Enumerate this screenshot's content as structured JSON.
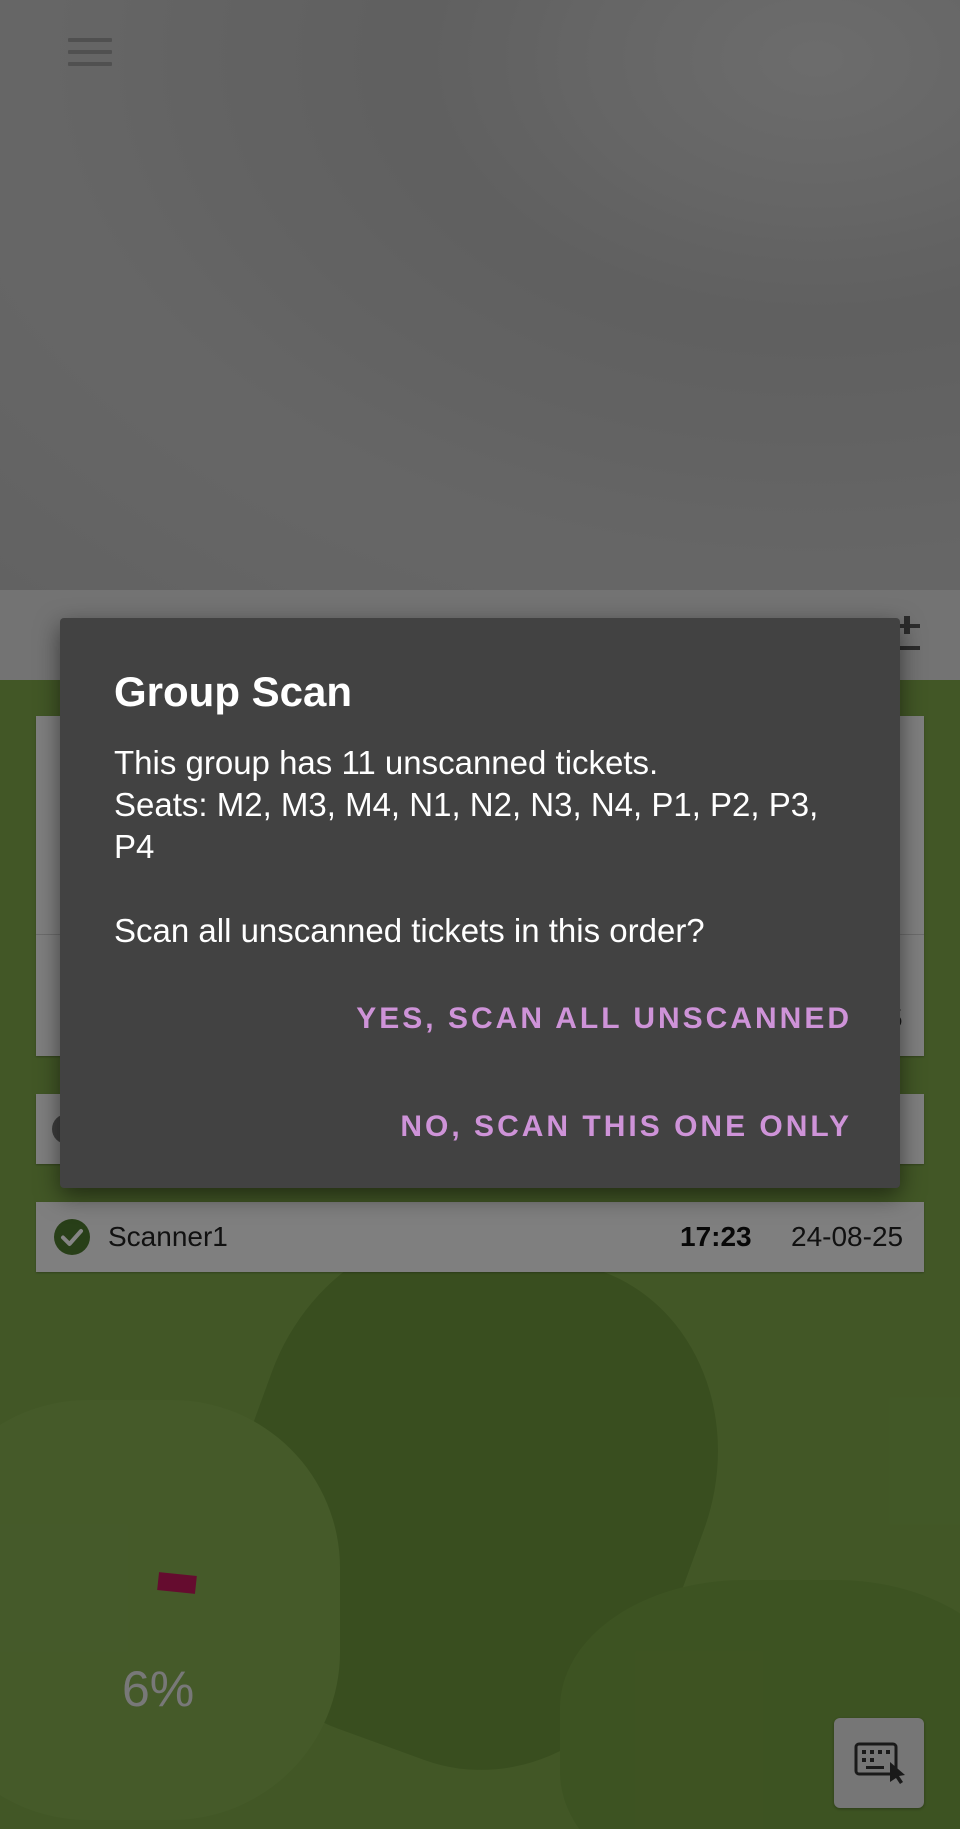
{
  "dialog": {
    "title": "Group Scan",
    "line1": "This group has 11 unscanned tickets.",
    "line2": "Seats: M2, M3, M4, N1, N2, N3, N4, P1, P2, P3, P4",
    "question": "Scan all unscanned tickets in this order?",
    "confirm_label": "YES, SCAN ALL UNSCANNED",
    "decline_label": "NO, SCAN THIS ONE ONLY"
  },
  "background": {
    "partial_digit": "5",
    "scan_row": {
      "name": "Scanner1",
      "time": "17:23",
      "date": "24-08-25"
    },
    "progress": {
      "label": "6%",
      "value": 6
    }
  },
  "colors": {
    "dialog_bg": "#424242",
    "accent": "#ce93d8",
    "check_green": "#4e7a2e",
    "progress_marker": "#c2185b"
  },
  "icons": {
    "menu": "menu-icon",
    "filter": "filter-settings-icon",
    "check": "check-circle-icon",
    "keyboard": "keyboard-input-icon"
  }
}
